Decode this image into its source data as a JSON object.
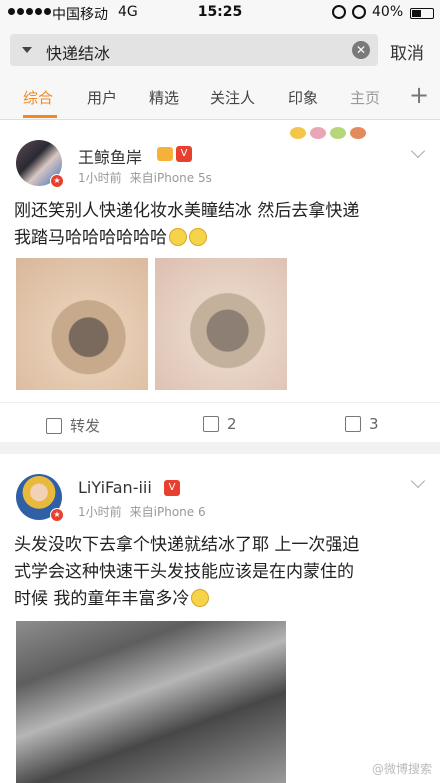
{
  "status_bar": {
    "carrier": "中国移动",
    "network": "4G",
    "time": "15:25",
    "battery": "40%",
    "battery_level": 0.4
  },
  "search": {
    "query": "快递结冰",
    "cancel_label": "取消",
    "clear_icon": "clear-icon"
  },
  "tabs": [
    {
      "label": "综合",
      "active": true
    },
    {
      "label": "用户"
    },
    {
      "label": "精选"
    },
    {
      "label": "关注人"
    },
    {
      "label": "印象"
    },
    {
      "label": "主页"
    }
  ],
  "posts": [
    {
      "username": "王鲸鱼岸",
      "time": "1小时前",
      "source": "来自iPhone 5s",
      "text_line1": "刚还笑别人快递化妆水美瞳结冰 然后去拿快递",
      "text_line2": "我踏马哈哈哈哈哈哈",
      "actions": {
        "repost": "转发",
        "comments": "2",
        "likes": "3"
      }
    },
    {
      "username": "LiYiFan-iii",
      "time": "1小时前",
      "source": "来自iPhone 6",
      "text_line1": "头发没吹下去拿个快递就结冰了耶 上一次强迫",
      "text_line2": "式学会这种快速干头发技能应该是在内蒙住的",
      "text_line3": "时候 我的童年丰富多冷"
    }
  ],
  "watermark": "@微博搜索"
}
